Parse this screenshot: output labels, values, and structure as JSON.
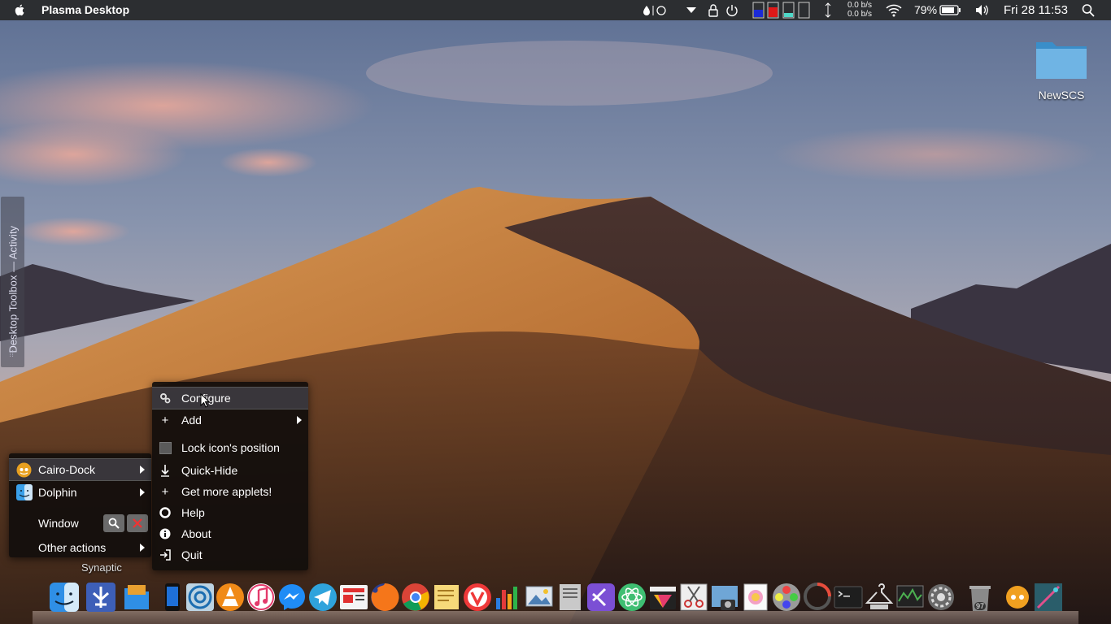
{
  "topbar": {
    "app_title": "Plasma Desktop",
    "net_up": "0.0 b/s",
    "net_down": "0.0 b/s",
    "battery_percent": "79%",
    "clock": "Fri 28  11:53"
  },
  "desktop": {
    "folder_label": "NewSCS",
    "toolbox_label": "Desktop Toolbox — Activity"
  },
  "left_menu": {
    "items": [
      {
        "label": "Cairo-Dock"
      },
      {
        "label": "Dolphin"
      },
      {
        "label": "Window"
      },
      {
        "label": "Other actions"
      }
    ],
    "hover_label": "Synaptic"
  },
  "right_menu": {
    "items": [
      {
        "label": "Configure"
      },
      {
        "label": "Add"
      },
      {
        "label": "Lock icon's position"
      },
      {
        "label": "Quick-Hide"
      },
      {
        "label": "Get more applets!"
      },
      {
        "label": "Help"
      },
      {
        "label": "About"
      },
      {
        "label": "Quit"
      }
    ]
  },
  "dock": {
    "trash_count": "97",
    "apps": [
      "finder",
      "kde-connect",
      "files",
      "phone",
      "disk-utility",
      "vlc",
      "itunes",
      "messenger",
      "telegram",
      "news",
      "firefox",
      "chrome",
      "notes",
      "vivaldi",
      "charts",
      "image-viewer",
      "text",
      "visual-studio",
      "atom",
      "final-cut",
      "scissors",
      "screenshot",
      "photos",
      "color-picker",
      "photocape",
      "terminal",
      "network",
      "system-monitor",
      "settings",
      "trash",
      "cairo-dock",
      "mystery"
    ]
  },
  "colors": {
    "panel": "#282828",
    "menu_bg": "#120e0c",
    "accent_blue": "#3b8fd8"
  }
}
